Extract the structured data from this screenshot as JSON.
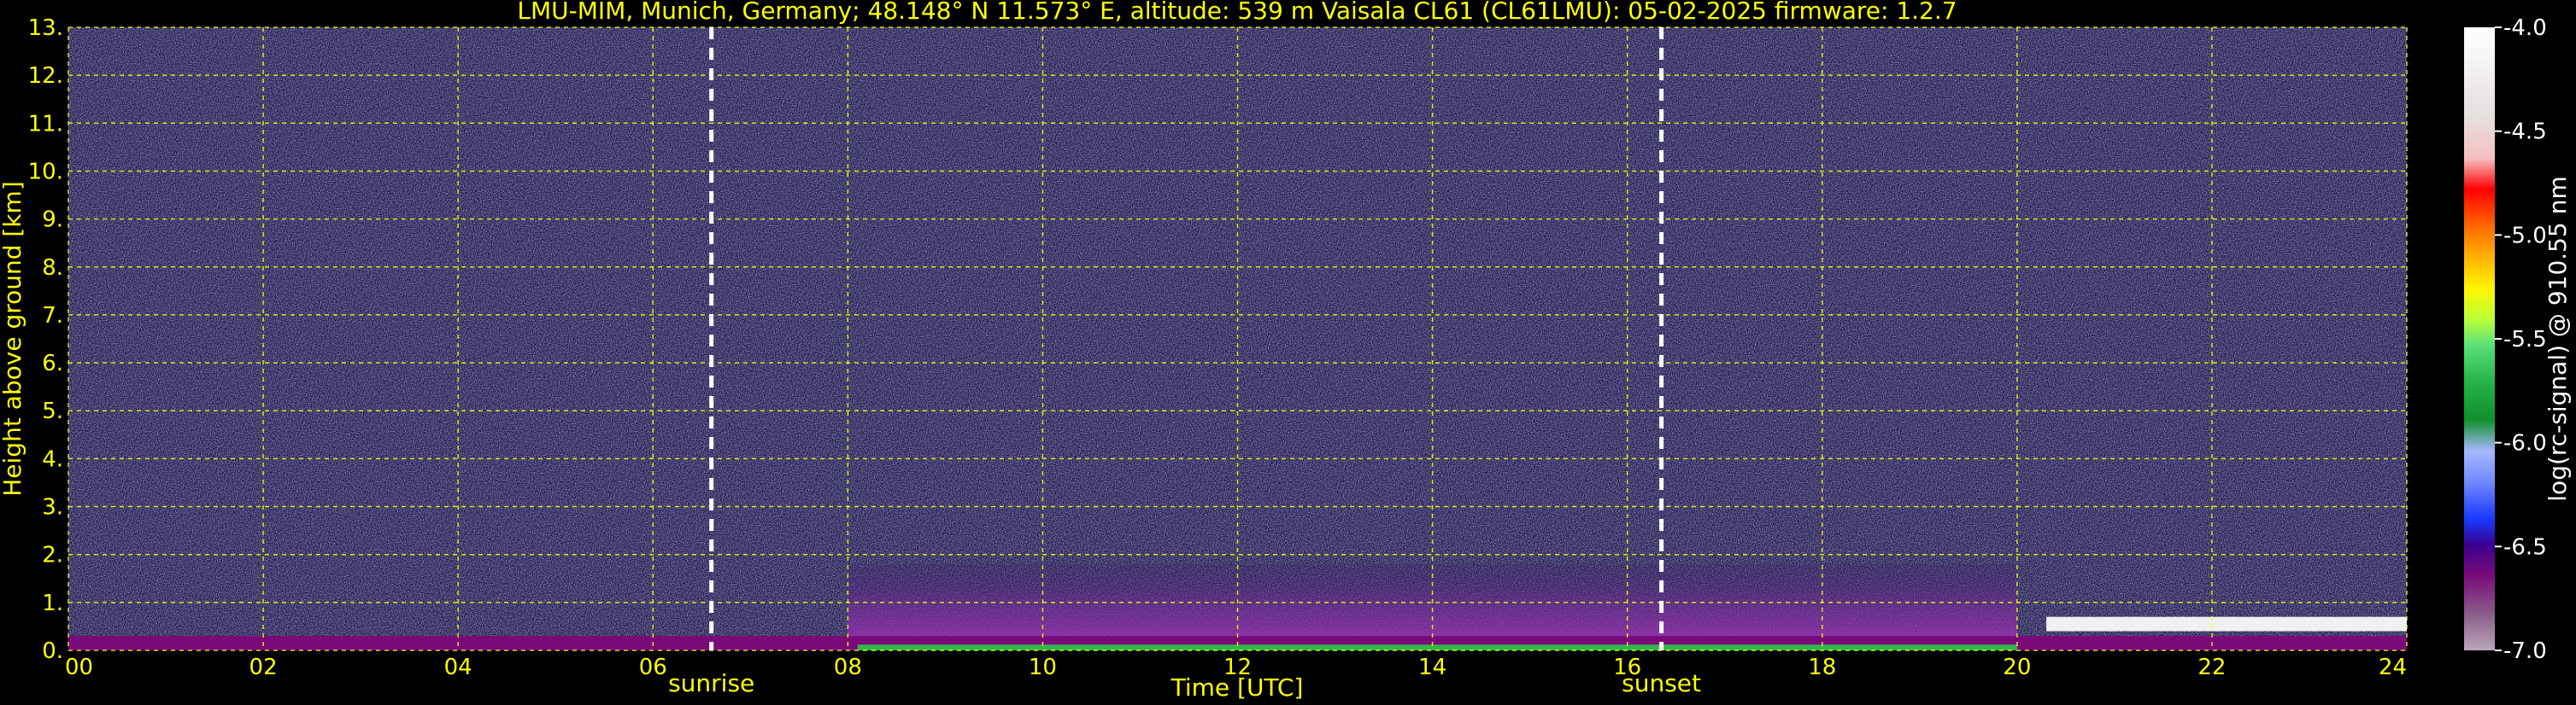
{
  "chart_data": {
    "type": "heatmap",
    "title": "LMU-MIM, Munich, Germany; 48.148° N 11.573° E, altitude: 539 m    Vaisala CL61 (CL61LMU): 05-02-2025    firmware: 1.2.7",
    "xlabel": "Time [UTC]",
    "ylabel": "Height above ground [km]",
    "xlim": [
      0,
      24
    ],
    "ylim": [
      0,
      13
    ],
    "x_ticks": [
      "00",
      "02",
      "04",
      "06",
      "08",
      "10",
      "12",
      "14",
      "16",
      "18",
      "20",
      "22",
      "24"
    ],
    "y_ticks": [
      "0.",
      "1.",
      "2.",
      "3.",
      "4.",
      "5.",
      "6.",
      "7.",
      "8.",
      "9.",
      "10.",
      "11.",
      "12.",
      "13."
    ],
    "grid": true,
    "markers": [
      {
        "label": "sunrise",
        "x": 6.6
      },
      {
        "label": "sunset",
        "x": 16.35
      }
    ],
    "colorbar": {
      "label": "log(rc-signal) @ 910.55 nm",
      "range": [
        -7.0,
        -4.0
      ],
      "ticks": [
        "-4.0",
        "-4.5",
        "-5.0",
        "-5.5",
        "-6.0",
        "-6.5",
        "-7.0"
      ]
    },
    "features": [
      {
        "description": "surface backscatter layer",
        "x_range": [
          0,
          24
        ],
        "top_km": 0.3
      },
      {
        "description": "aerosol boundary layer",
        "x_range": [
          8,
          20
        ],
        "top_km": 1.8
      },
      {
        "description": "low cloud layer",
        "x_range": [
          20.3,
          24
        ],
        "top_km": 0.9
      }
    ]
  },
  "colors": {
    "text": "#ffff00",
    "background": "#000000",
    "grid": "#ffff00",
    "marker": "#ffffff"
  }
}
